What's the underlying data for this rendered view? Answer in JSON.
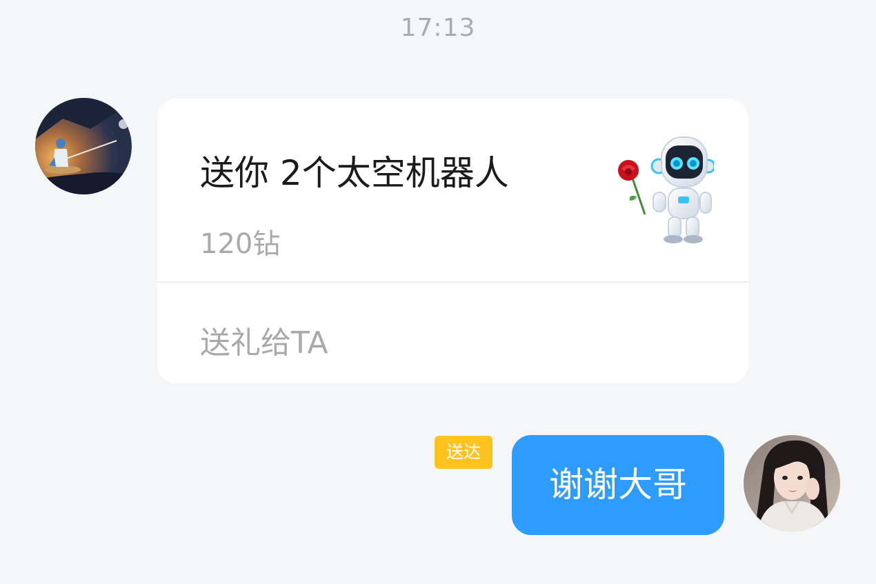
{
  "chat": {
    "timestamp": "17:13",
    "incoming": {
      "avatar_icon": "avatar-fisherman-night-icon",
      "gift_card": {
        "title": "送你 2个太空机器人",
        "price": "120钻",
        "action_label": "送礼给TA",
        "gift_icon": "space-robot-with-rose-icon"
      }
    },
    "outgoing": {
      "status_badge": "送达",
      "message": "谢谢大哥",
      "avatar_icon": "avatar-girl-photo-icon"
    }
  },
  "colors": {
    "background": "#f5f6f8",
    "card": "#ffffff",
    "sent_bubble": "#2e9bff",
    "badge": "#ffc21f",
    "muted_text": "#a9a9ab",
    "primary_text": "#1b1b1b"
  }
}
